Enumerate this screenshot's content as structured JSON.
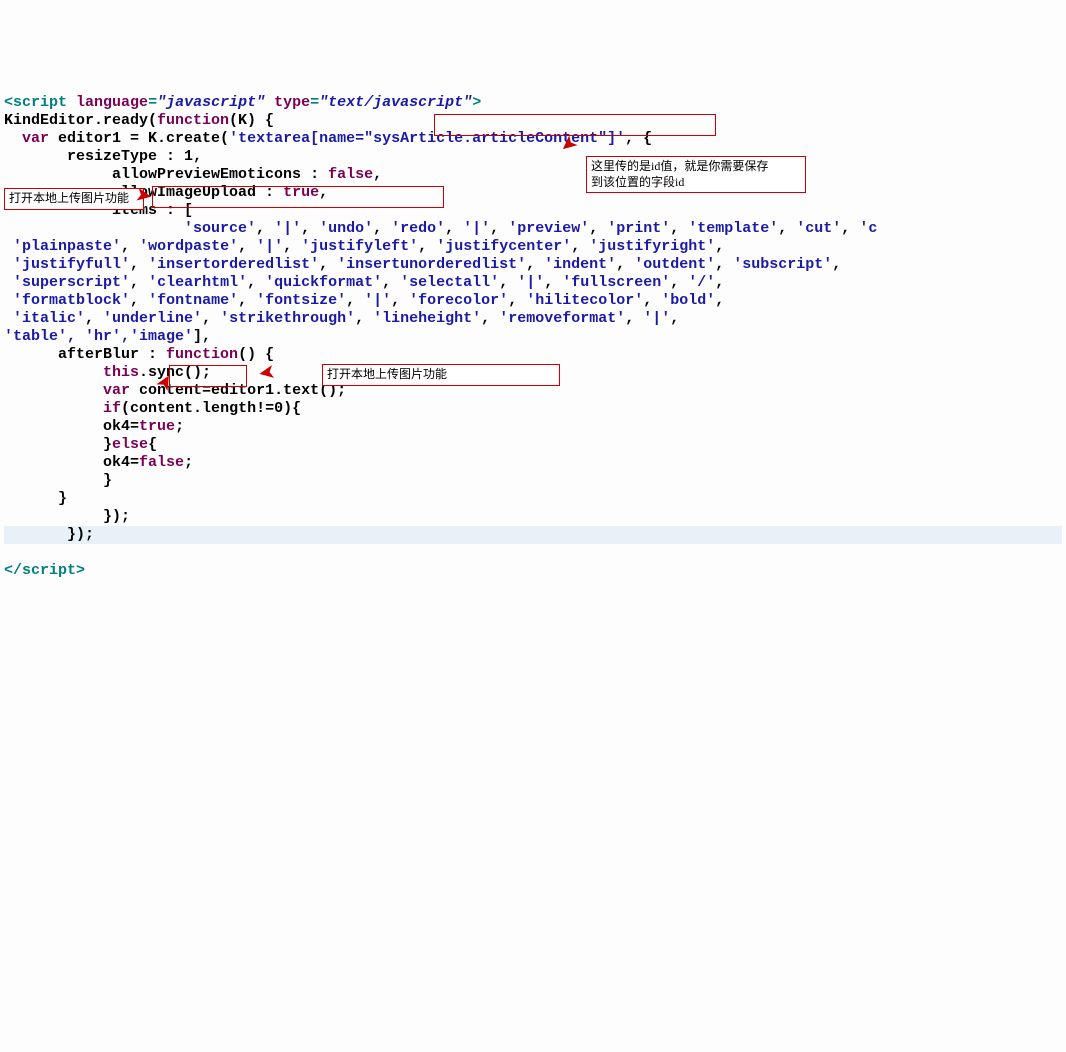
{
  "code": {
    "line1": {
      "open_bracket": "<",
      "tag": "script",
      "sp": " ",
      "attr1": "language",
      "eq": "=",
      "val1": "\"javascript\"",
      "attr2": "type",
      "val2": "\"text/javascript\"",
      "close_bracket": ">"
    },
    "line2": {
      "text": "KindEditor.ready(",
      "kw": "function",
      "rest": "(K) {"
    },
    "line3": {
      "indent": "  ",
      "kw": "var",
      "sp": " editor1 = K.create(",
      "s1": "'textarea[name=\"",
      "s2": "sysArticle.articleContent",
      "s3": "\"]'",
      "rest": ", {"
    },
    "line4": {
      "indent": "       ",
      "key": "resizeType : ",
      "val": "1",
      "comma": ","
    },
    "line5": {
      "indent": "            ",
      "key": "allowPreviewEmoticons : ",
      "val": "false",
      "comma": ","
    },
    "line6": {
      "indent": "            ",
      "key": "allowImageUpload : ",
      "val": "true",
      "comma": ","
    },
    "line7": {
      "indent": "            ",
      "key": "items : ["
    },
    "items_lines": [
      "                    'source', '|', 'undo', 'redo', '|', 'preview', 'print', 'template', 'cut', 'c",
      " 'plainpaste', 'wordpaste', '|', 'justifyleft', 'justifycenter', 'justifyright',",
      " 'justifyfull', 'insertorderedlist', 'insertunorderedlist', 'indent', 'outdent', 'subscript',",
      " 'superscript', 'clearhtml', 'quickformat', 'selectall', '|', 'fullscreen', '/',",
      " 'formatblock', 'fontname', 'fontsize', '|', 'forecolor', 'hilitecolor', 'bold',",
      " 'italic', 'underline', 'strikethrough', 'lineheight', 'removeformat', '|',"
    ],
    "last_items": {
      "pre": "'table', 'hr',",
      "img": "'image'",
      "post": "],"
    },
    "after1": {
      "indent": "      ",
      "key": "afterBlur : ",
      "kw": "function",
      "rest": "() {"
    },
    "after2": {
      "indent": "           ",
      "kw": "this",
      "rest": ".sync();"
    },
    "after3": {
      "indent": "           ",
      "kw": "var",
      "rest": " content=editor1.text();"
    },
    "after4": {
      "indent": "           ",
      "kw": "if",
      "rest": "(content.length!=0){"
    },
    "after5": {
      "indent": "           ",
      "lhs": "ok4=",
      "val": "true",
      "semi": ";"
    },
    "after6": {
      "indent": "           ",
      "text": "}",
      "kw": "else",
      "rest": "{"
    },
    "after7": {
      "indent": "           ",
      "lhs": "ok4=",
      "val": "false",
      "semi": ";"
    },
    "after8": {
      "indent": "           ",
      "text": "}"
    },
    "after9": {
      "indent": "      ",
      "text": "}"
    },
    "after10": {
      "indent": "           ",
      "text": "});"
    },
    "after11": {
      "indent": "       ",
      "text": "});"
    },
    "close": {
      "open": "</",
      "tag": "script",
      "close": ">"
    }
  },
  "annotations": {
    "left_label": "打开本地上传图片功能",
    "right_label_l1": "这里传的是id值，就是你需要保存",
    "right_label_l2": "到该位置的字段id",
    "bottom_label": "打开本地上传图片功能"
  }
}
